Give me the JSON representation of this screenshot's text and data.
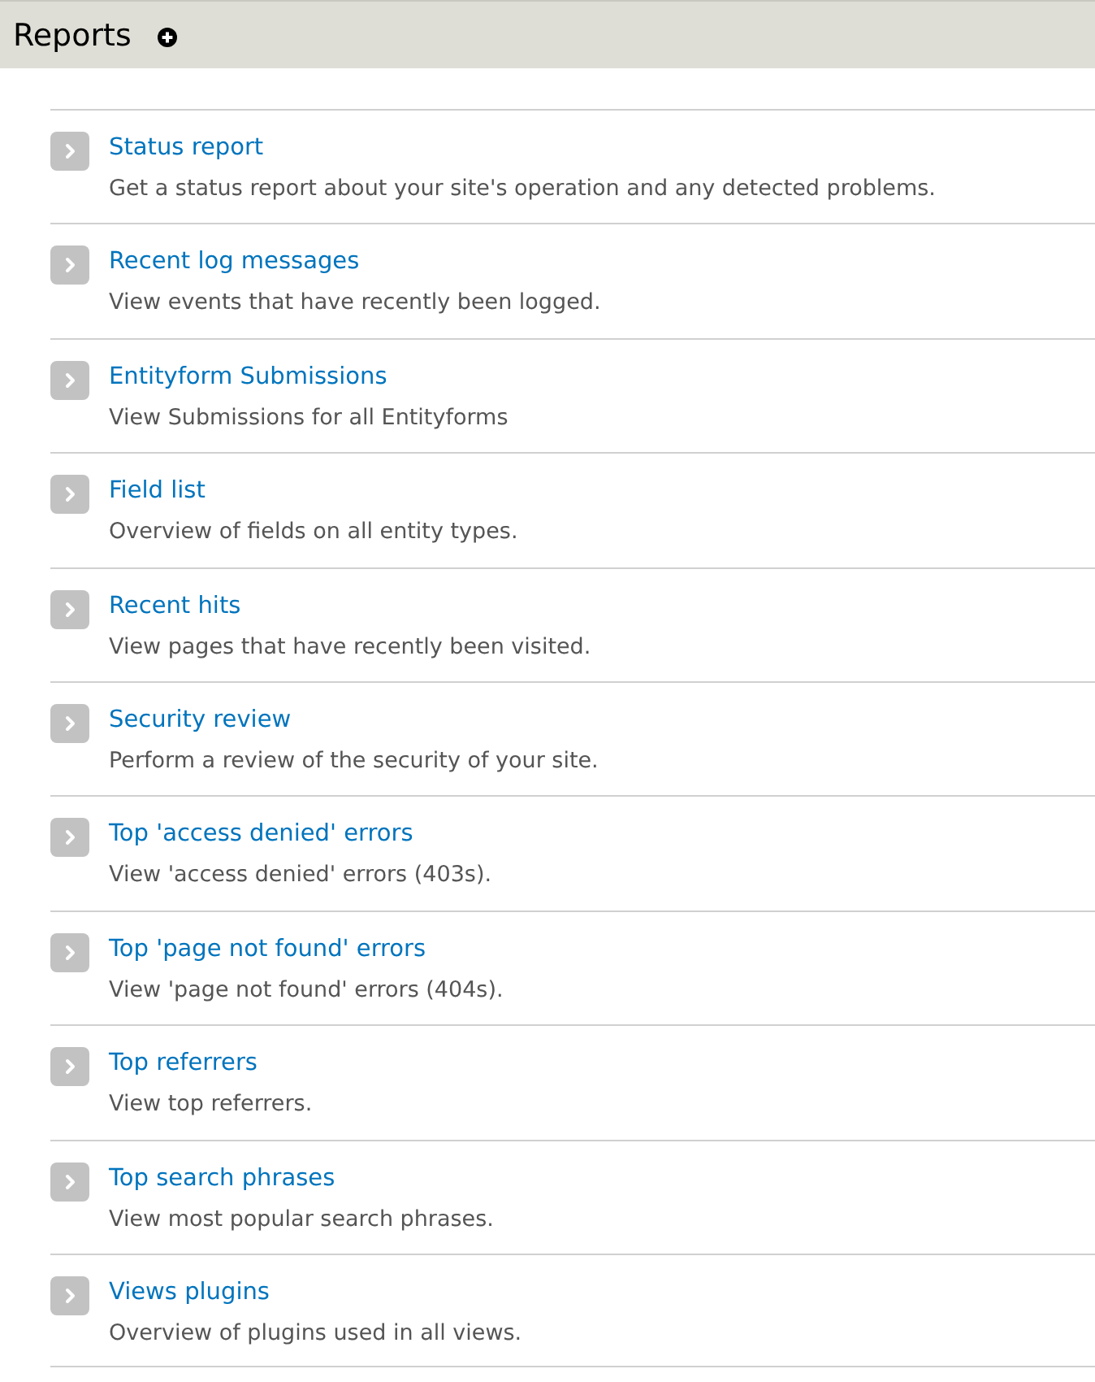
{
  "header": {
    "title": "Reports"
  },
  "items": [
    {
      "title": "Status report",
      "description": "Get a status report about your site's operation and any detected problems."
    },
    {
      "title": "Recent log messages",
      "description": "View events that have recently been logged."
    },
    {
      "title": "Entityform Submissions",
      "description": "View Submissions for all Entityforms"
    },
    {
      "title": "Field list",
      "description": "Overview of fields on all entity types."
    },
    {
      "title": "Recent hits",
      "description": "View pages that have recently been visited."
    },
    {
      "title": "Security review",
      "description": "Perform a review of the security of your site."
    },
    {
      "title": "Top 'access denied' errors",
      "description": "View 'access denied' errors (403s)."
    },
    {
      "title": "Top 'page not found' errors",
      "description": "View 'page not found' errors (404s)."
    },
    {
      "title": "Top referrers",
      "description": "View top referrers."
    },
    {
      "title": "Top search phrases",
      "description": "View most popular search phrases."
    },
    {
      "title": "Views plugins",
      "description": "Overview of plugins used in all views."
    }
  ]
}
